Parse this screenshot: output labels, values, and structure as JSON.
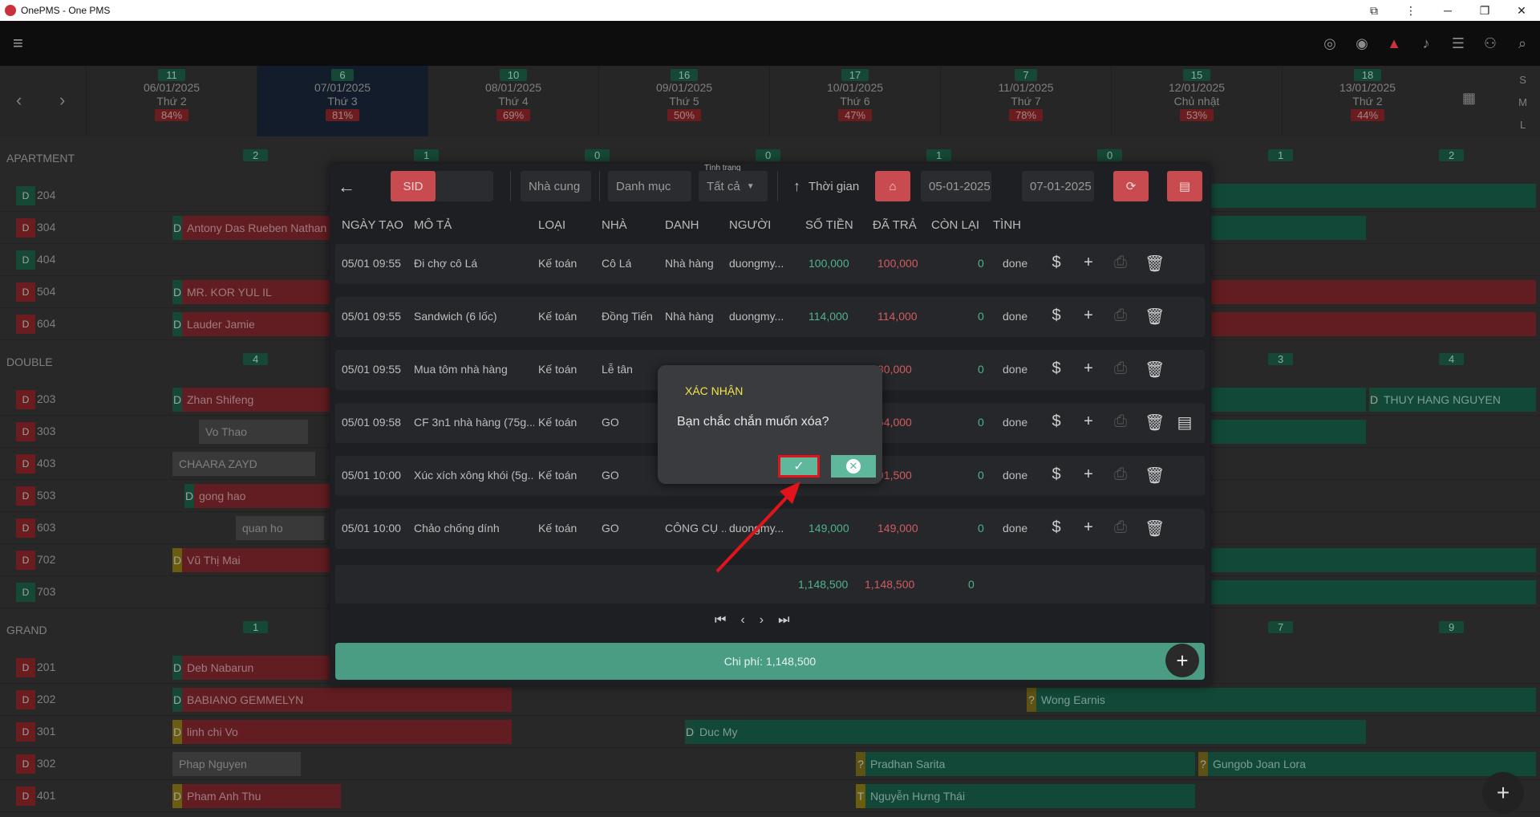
{
  "window": {
    "title": "OnePMS - One PMS"
  },
  "dates": [
    {
      "count": "11",
      "date": "06/01/2025",
      "day": "Thứ 2",
      "pct": "84%"
    },
    {
      "count": "6",
      "date": "07/01/2025",
      "day": "Thứ 3",
      "pct": "81%"
    },
    {
      "count": "10",
      "date": "08/01/2025",
      "day": "Thứ 4",
      "pct": "69%"
    },
    {
      "count": "16",
      "date": "09/01/2025",
      "day": "Thứ 5",
      "pct": "50%"
    },
    {
      "count": "17",
      "date": "10/01/2025",
      "day": "Thứ 6",
      "pct": "47%"
    },
    {
      "count": "7",
      "date": "11/01/2025",
      "day": "Thứ 7",
      "pct": "78%"
    },
    {
      "count": "15",
      "date": "12/01/2025",
      "day": "Chủ nhật",
      "pct": "53%"
    },
    {
      "count": "18",
      "date": "13/01/2025",
      "day": "Thứ 2",
      "pct": "44%"
    }
  ],
  "size_toggle": [
    "S",
    "M",
    "L"
  ],
  "grid": {
    "apartment": {
      "name": "APARTMENT",
      "badges": [
        "2",
        "1",
        "0",
        "0",
        "1",
        "0",
        "1",
        "2"
      ]
    },
    "double": {
      "name": "DOUBLE",
      "badges": [
        "4",
        "3",
        "4"
      ]
    },
    "grand": {
      "name": "GRAND",
      "badges": [
        "1",
        "7",
        "9"
      ]
    },
    "tag": "D",
    "rooms": {
      "r204": "204",
      "r304": "304",
      "r404": "404",
      "r504": "504",
      "r604": "604",
      "r203": "203",
      "r303": "303",
      "r403": "403",
      "r503": "503",
      "r603": "603",
      "r702": "702",
      "r703": "703",
      "r201": "201",
      "r202": "202",
      "r301": "301",
      "r302": "302",
      "r401": "401"
    },
    "guests": {
      "g304": "Antony Das Rueben Nathan",
      "g504": "MR. KOR YUL IL",
      "g604": "Lauder Jamie",
      "g203": "Zhan Shifeng",
      "g203b": "THUY HANG NGUYEN",
      "g303": "Vo Thao",
      "g403": "CHAARA ZAYD",
      "g503": "gong hao",
      "g603": "quan ho",
      "g702": "Vũ Thị Mai",
      "g201": "Deb Nabarun",
      "g202": "BABIANO GEMMELYN",
      "g202b": "Wong Earnis",
      "g301": "linh chi Vo",
      "g301b": "Duc My",
      "g302": "Phap Nguyen",
      "g302b": "Pradhan Sarita",
      "g302c": "Gungob Joan Lora",
      "g401": "Pham Anh Thu",
      "g401b": "Nguyễn Hưng Thái"
    }
  },
  "toolbar": {
    "sid": "SID",
    "supplier_placeholder": "Nhà cung",
    "category_placeholder": "Danh mục",
    "status_label": "Tình trạng",
    "status_value": "Tất cả",
    "time_label": "Thời gian",
    "date_from": "05-01-2025",
    "date_to": "07-01-2025"
  },
  "table": {
    "headers": [
      "NGÀY TẠO",
      "MÔ TẢ",
      "LOẠI",
      "NHÀ",
      "DANH",
      "NGƯỜI",
      "SỐ TIỀN",
      "ĐÃ TRẢ",
      "CÒN LẠI",
      "TÌNH"
    ],
    "rows": [
      {
        "date": "05/01 09:55",
        "desc": "Đi chợ cô Lá",
        "type": "Kế toán",
        "vendor": "Cô Lá",
        "cat": "Nhà hàng",
        "user": "duongmy...",
        "amount": "100,000",
        "paid": "100,000",
        "remain": "0",
        "status": "done"
      },
      {
        "date": "05/01 09:55",
        "desc": "Sandwich (6 lốc)",
        "type": "Kế toán",
        "vendor": "Đồng Tiến",
        "cat": "Nhà hàng",
        "user": "duongmy...",
        "amount": "114,000",
        "paid": "114,000",
        "remain": "0",
        "status": "done"
      },
      {
        "date": "05/01 09:55",
        "desc": "Mua tôm nhà hàng",
        "type": "Kế toán",
        "vendor": "Lễ tân",
        "cat": "",
        "user": "",
        "amount": "",
        "paid": "30,000",
        "remain": "0",
        "status": "done"
      },
      {
        "date": "05/01 09:58",
        "desc": "CF 3n1 nhà hàng (75g...",
        "type": "Kế toán",
        "vendor": "GO",
        "cat": "",
        "user": "",
        "amount": "",
        "paid": "64,000",
        "remain": "0",
        "status": "done"
      },
      {
        "date": "05/01 10:00",
        "desc": "Xúc xích xông khói (5g...",
        "type": "Kế toán",
        "vendor": "GO",
        "cat": "",
        "user": "",
        "amount": "",
        "paid": "91,500",
        "remain": "0",
        "status": "done"
      },
      {
        "date": "05/01 10:00",
        "desc": "Chảo chống dính",
        "type": "Kế toán",
        "vendor": "GO",
        "cat": "CÔNG CỤ ...",
        "user": "duongmy...",
        "amount": "149,000",
        "paid": "149,000",
        "remain": "0",
        "status": "done"
      }
    ],
    "totals": {
      "amount": "1,148,500",
      "paid": "1,148,500",
      "remain": "0"
    }
  },
  "cost_bar": "Chi phí: 1,148,500",
  "dialog": {
    "title": "XÁC NHẬN",
    "message": "Bạn chắc chắn muốn xóa?"
  },
  "colors": {
    "accent_green": "#5fb89c",
    "accent_red": "#c74b4f",
    "highlight": "#e0141a",
    "title_yellow": "#f2e64a"
  }
}
